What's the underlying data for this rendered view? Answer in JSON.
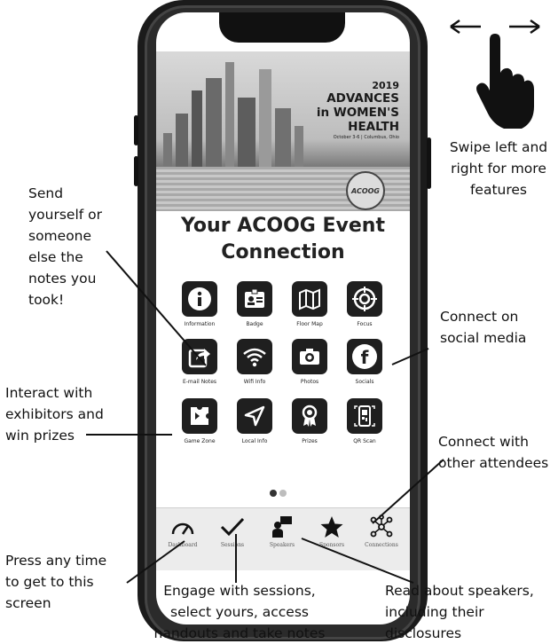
{
  "banner": {
    "year": "2019",
    "line1": "ADVANCES",
    "line2": "in WOMEN'S",
    "line3": "HEALTH",
    "subline": "October 3-6 | Columbus, Ohio",
    "seal_text": "ACOOG"
  },
  "heading": {
    "line1": "Your ACOOG Event",
    "line2": "Connection"
  },
  "tiles": [
    {
      "label": "Information",
      "icon": "info-icon"
    },
    {
      "label": "Badge",
      "icon": "badge-icon"
    },
    {
      "label": "Floor Map",
      "icon": "map-icon"
    },
    {
      "label": "Focus",
      "icon": "focus-icon"
    },
    {
      "label": "E-mail Notes",
      "icon": "share-arrow-icon"
    },
    {
      "label": "Wifi Info",
      "icon": "wifi-icon"
    },
    {
      "label": "Photos",
      "icon": "camera-icon"
    },
    {
      "label": "Socials",
      "icon": "facebook-icon"
    },
    {
      "label": "Game Zone",
      "icon": "puzzle-icon"
    },
    {
      "label": "Local Info",
      "icon": "navigation-arrow-icon"
    },
    {
      "label": "Prizes",
      "icon": "award-ribbon-icon"
    },
    {
      "label": "QR Scan",
      "icon": "qr-scan-icon"
    }
  ],
  "pager": {
    "pages": 2,
    "current": 1
  },
  "tabbar": [
    {
      "label": "Dashboard",
      "icon": "speedometer-icon"
    },
    {
      "label": "Sessions",
      "icon": "checkmark-icon"
    },
    {
      "label": "Speakers",
      "icon": "presenter-icon"
    },
    {
      "label": "Sponsors",
      "icon": "star-icon"
    },
    {
      "label": "Connections",
      "icon": "network-icon"
    }
  ],
  "callouts": {
    "swipe": [
      "Swipe left and",
      "right for more",
      "features"
    ],
    "send_notes": [
      "Send",
      "yourself or",
      "someone",
      "else the",
      "notes you",
      "took!"
    ],
    "social": [
      "Connect on",
      "social media"
    ],
    "exhibitors": [
      "Interact with",
      "exhibitors and",
      "win prizes"
    ],
    "attendees": [
      "Connect with",
      "other attendees"
    ],
    "dashboard": [
      "Press any time",
      "to get to this",
      "screen"
    ],
    "sessions": [
      "Engage with sessions,",
      "select yours, access",
      "handouts and take notes"
    ],
    "speakers": [
      "Read about speakers,",
      "including their",
      "disclosures"
    ]
  },
  "colors": {
    "tile_bg": "#1f1f1f",
    "tab_bg": "#ececec",
    "dot_active": "#333333",
    "dot_inactive": "#bdbdbd"
  }
}
